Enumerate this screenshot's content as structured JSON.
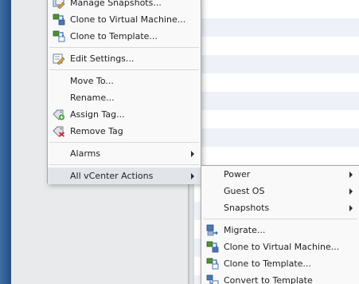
{
  "colors": {
    "menu_background": "#f9f9f9",
    "menu_active": "#e1e5ea",
    "left_pane": "#2d5a92",
    "grid_alt_row": "#eef2f8"
  },
  "primary_menu": {
    "items": [
      {
        "label": "Manage Snapshots...",
        "icon": "manage-snapshots-icon"
      },
      {
        "label": "Clone to Virtual Machine...",
        "icon": "clone-to-vm-icon"
      },
      {
        "label": "Clone to Template...",
        "icon": "clone-to-template-icon"
      },
      {
        "label": "Edit Settings...",
        "icon": "edit-settings-icon"
      },
      {
        "label": "Move To..."
      },
      {
        "label": "Rename..."
      },
      {
        "label": "Assign Tag...",
        "icon": "assign-tag-icon"
      },
      {
        "label": "Remove Tag",
        "icon": "remove-tag-icon"
      },
      {
        "label": "Alarms",
        "submenu": true
      },
      {
        "label": "All vCenter Actions",
        "submenu": true,
        "active": true
      }
    ]
  },
  "secondary_menu": {
    "items": [
      {
        "label": "Power",
        "submenu": true
      },
      {
        "label": "Guest OS",
        "submenu": true
      },
      {
        "label": "Snapshots",
        "submenu": true
      },
      {
        "label": "Migrate...",
        "icon": "migrate-icon"
      },
      {
        "label": "Clone to Virtual Machine...",
        "icon": "clone-to-vm-icon"
      },
      {
        "label": "Clone to Template...",
        "icon": "clone-to-template-icon"
      },
      {
        "label": "Convert to Template",
        "icon": "convert-to-template-icon"
      }
    ]
  }
}
